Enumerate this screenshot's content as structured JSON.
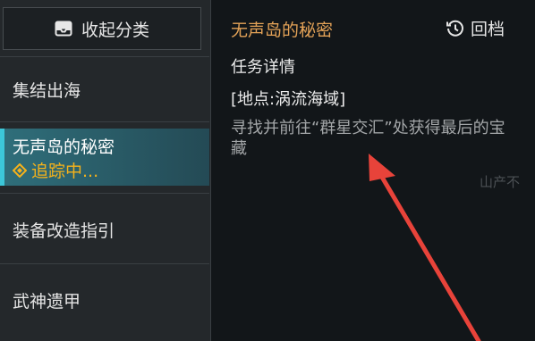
{
  "sidebar": {
    "collapse_label": "收起分类",
    "items": [
      {
        "label": "集结出海"
      },
      {
        "label": "无声岛的秘密",
        "status": "追踪中..."
      },
      {
        "label": "装备改造指引"
      },
      {
        "label": "武神遗甲"
      }
    ]
  },
  "quest": {
    "title": "无声岛的秘密",
    "rewind_label": "回档",
    "section_label": "任务详情",
    "location": "[地点:涡流海域]",
    "description": "寻找并前往“群星交汇”处获得最后的宝藏",
    "faint_text": "山产不"
  },
  "annotation": {
    "color": "#e8433a"
  },
  "colors": {
    "accent_title": "#e3a257",
    "tracking": "#f5b21b",
    "active_bar": "#3cc7d9"
  }
}
